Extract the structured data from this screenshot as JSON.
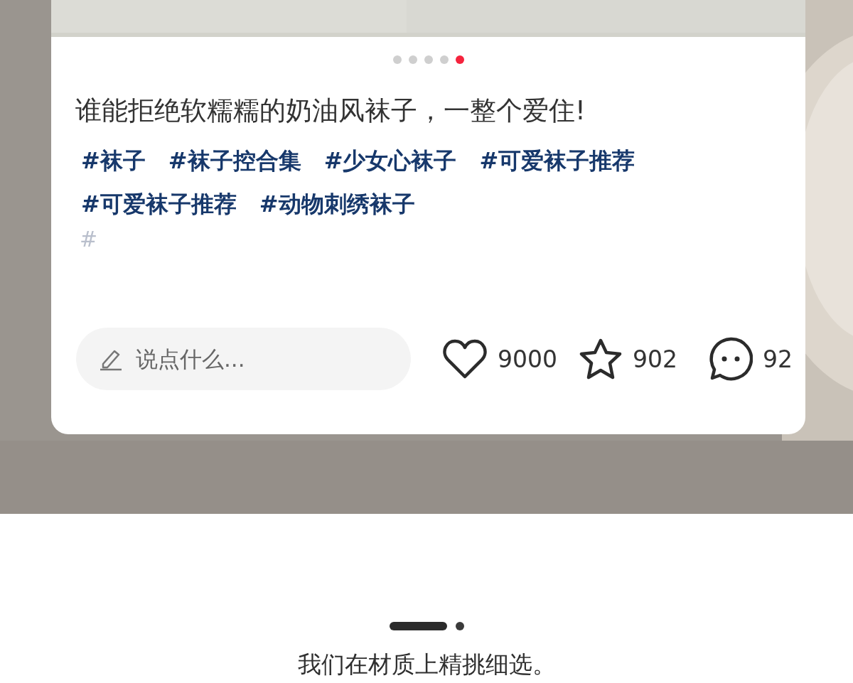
{
  "carousel": {
    "dots": [
      {
        "selected": false
      },
      {
        "selected": false
      },
      {
        "selected": false
      },
      {
        "selected": false
      },
      {
        "selected": true
      }
    ]
  },
  "post": {
    "title": "谁能拒绝软糯糯的奶油风袜子，一整个爱住!",
    "tags": [
      "#袜子",
      "#袜子控合集",
      "#少女心袜子",
      "#可爱袜子推荐",
      "#可爱袜子推荐",
      "#动物刺绣袜子"
    ],
    "faded_tag": "#"
  },
  "comment_box": {
    "placeholder": "说点什么..."
  },
  "actions": [
    {
      "kind": "like",
      "count": "9000"
    },
    {
      "kind": "star",
      "count": "902"
    },
    {
      "kind": "comment",
      "count": "92"
    }
  ],
  "pager": [
    {
      "selected": true
    },
    {
      "selected": false
    }
  ],
  "caption": "我们在材质上精挑细选。"
}
